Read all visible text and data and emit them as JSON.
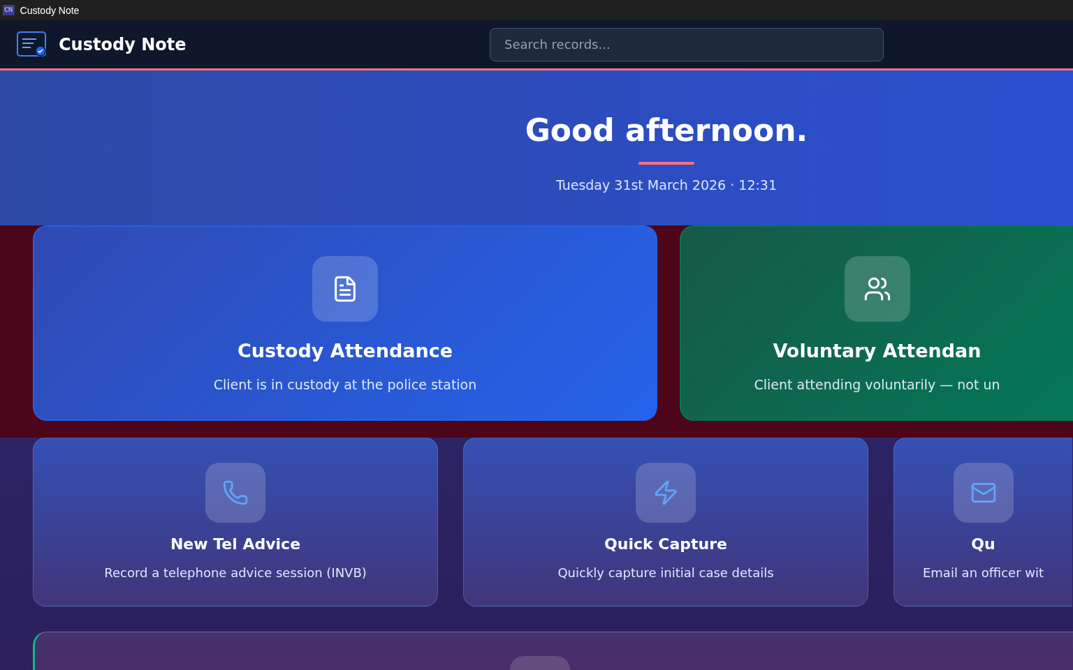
{
  "window": {
    "title": "Custody Note",
    "badge": "CN"
  },
  "header": {
    "brand": "Custody Note",
    "search": {
      "placeholder": "Search records..."
    }
  },
  "hero": {
    "greeting": "Good afternoon.",
    "date": "Tuesday 31st March 2026 · 12:31"
  },
  "primary_cards": [
    {
      "kind": "document",
      "title": "Custody Attendance",
      "description": "Client is in custody at the police station",
      "color": "#2563eb"
    },
    {
      "kind": "people",
      "title": "Voluntary Attendan",
      "description": "Client attending voluntarily — not un",
      "color": "#047857"
    }
  ],
  "secondary_cards": [
    {
      "kind": "phone",
      "title": "New Tel Advice",
      "description": "Record a telephone advice session (INVB)"
    },
    {
      "kind": "bolt",
      "title": "Quick Capture",
      "description": "Quickly capture initial case details"
    },
    {
      "kind": "mail",
      "title": "Qu",
      "description": "Email an officer wit"
    }
  ]
}
